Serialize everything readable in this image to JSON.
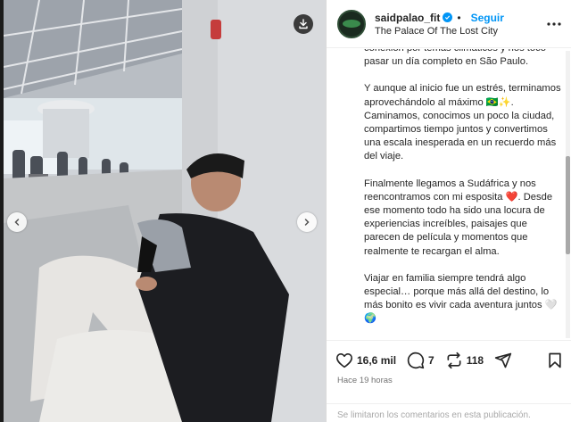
{
  "post": {
    "username": "saidpalao_fit",
    "separator": "•",
    "follow_label": "Seguir",
    "location": "The Palace Of The Lost City"
  },
  "caption": {
    "paragraphs": [
      "conexión por temas climáticos y nos tocó pasar un día completo en São Paulo.",
      "Y aunque al inicio fue un estrés, terminamos aprovechándolo al máximo 🇧🇷✨. Caminamos, conocimos un poco la ciudad, compartimos tiempo juntos y convertimos una escala inesperada en un recuerdo más del viaje.",
      "Finalmente llegamos a Sudáfrica y nos reencontramos con mi esposita ❤️. Desde ese momento todo ha sido una locura de experiencias increíbles, paisajes que parecen de película y momentos que realmente te recargan el alma.",
      "Viajar en familia siempre tendrá algo especial… porque más allá del destino, lo más bonito es vivir cada aventura juntos 🤍🌍"
    ]
  },
  "actions": {
    "likes": "16,6 mil",
    "comments": "7",
    "reposts": "118"
  },
  "timestamp": "Hace 19 horas",
  "comment_notice": "Se limitaron los comentarios en esta publicación.",
  "icons": {
    "save_media": "download-icon",
    "prev": "chevron-left-icon",
    "next": "chevron-right-icon",
    "verified": "verified-badge-icon",
    "more": "more-options-icon",
    "like": "heart-icon",
    "comment": "comment-icon",
    "repost": "repost-icon",
    "share": "send-icon",
    "save": "bookmark-icon"
  },
  "colors": {
    "accent": "#0095f6",
    "text": "#262626",
    "muted": "#737373"
  }
}
